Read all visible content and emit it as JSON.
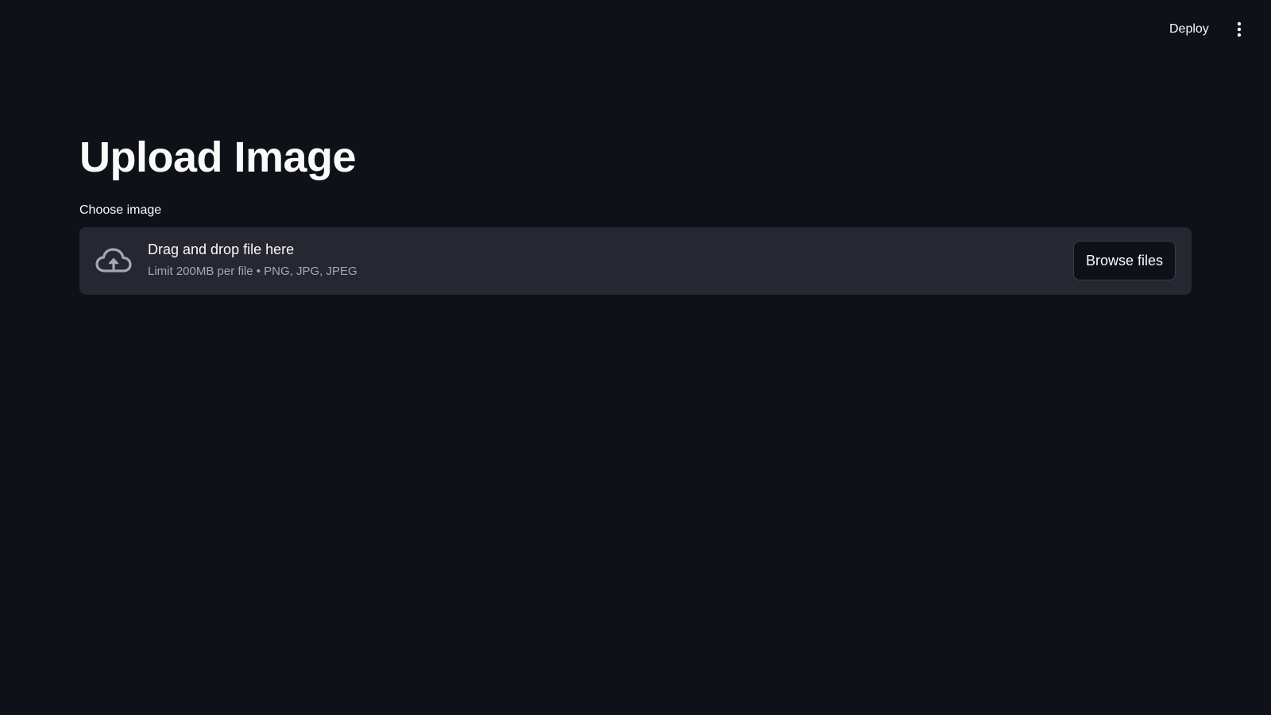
{
  "header": {
    "deploy_label": "Deploy",
    "menu_icon": "vertical-ellipsis-icon"
  },
  "main": {
    "title": "Upload Image",
    "uploader": {
      "label": "Choose image",
      "icon": "cloud-upload-icon",
      "instructions": "Drag and drop file here",
      "limits": "Limit 200MB per file • PNG, JPG, JPEG",
      "browse_label": "Browse files"
    }
  },
  "colors": {
    "background": "#0e1117",
    "dropzone": "#262730",
    "text": "#fafafa",
    "muted_text": "#a3a8b8"
  }
}
